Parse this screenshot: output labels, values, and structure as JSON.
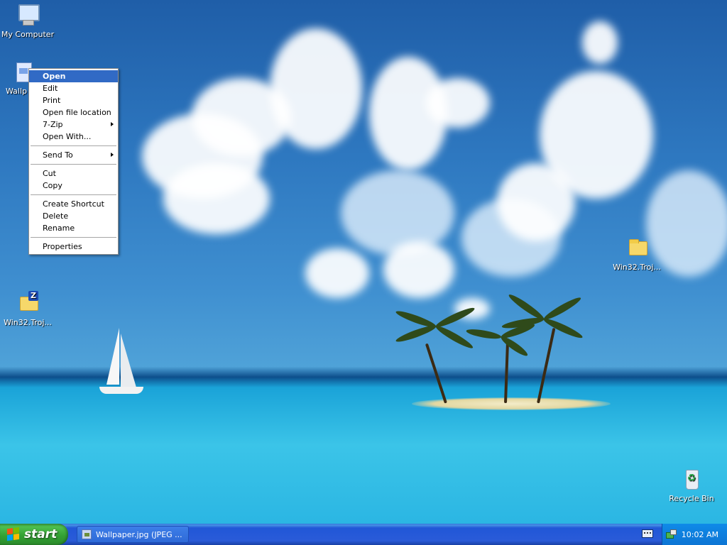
{
  "desktop": {
    "icons": [
      {
        "label": "My Computer",
        "icon": "my-computer-icon"
      },
      {
        "label": "Wallp",
        "icon": "image-file-icon"
      },
      {
        "label": "Win32.Troj...",
        "icon": "zip-folder-icon"
      },
      {
        "label": "Win32.Troj...",
        "icon": "folder-icon"
      },
      {
        "label": "Recycle Bin",
        "icon": "recycle-bin-icon"
      }
    ]
  },
  "context_menu": {
    "items": [
      {
        "label": "Open",
        "highlighted": true
      },
      {
        "label": "Edit"
      },
      {
        "label": "Print"
      },
      {
        "label": "Open file location"
      },
      {
        "label": "7-Zip",
        "submenu": true
      },
      {
        "label": "Open With..."
      },
      {
        "label": "Send To",
        "submenu": true
      },
      {
        "label": "Cut"
      },
      {
        "label": "Copy"
      },
      {
        "label": "Create Shortcut"
      },
      {
        "label": "Delete"
      },
      {
        "label": "Rename"
      },
      {
        "label": "Properties"
      }
    ]
  },
  "taskbar": {
    "start_label": "start",
    "tasks": [
      {
        "label": "Wallpaper.jpg (JPEG ...",
        "icon": "image-viewer-icon"
      }
    ],
    "tray": {
      "clock": "10:02 AM",
      "icons": [
        "keyboard-icon",
        "network-icon"
      ]
    }
  },
  "colors": {
    "menu_highlight": "#316ac5",
    "taskbar": "#245edb",
    "start_button": "#3c9c3c"
  }
}
